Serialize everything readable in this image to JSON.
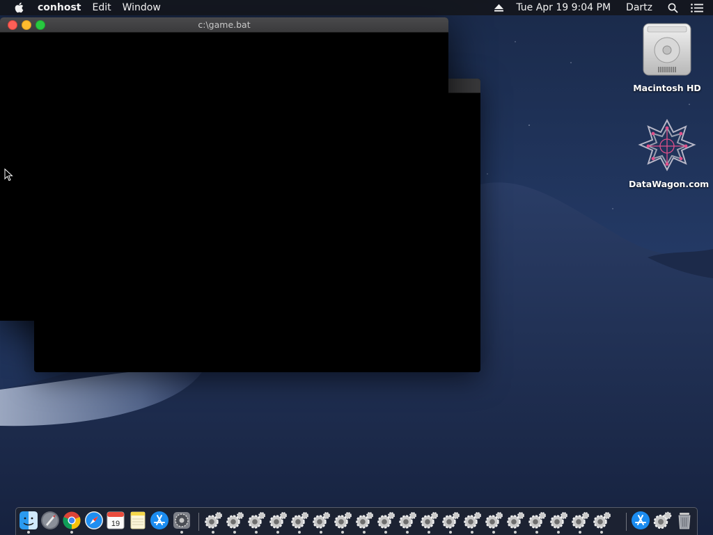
{
  "menubar": {
    "app_name": "conhost",
    "menus": [
      "Edit",
      "Window"
    ],
    "datetime": "Tue Apr 19  9:04 PM",
    "user": "Dartz",
    "icons": [
      "apple-icon",
      "eject-icon",
      "spotlight-icon",
      "notification-center-icon"
    ]
  },
  "window": {
    "title": "c:\\game.bat"
  },
  "desktop": {
    "icons": [
      {
        "label": "Macintosh HD",
        "icon": "hard-drive-icon"
      },
      {
        "label": "DataWagon.com",
        "icon": "network-volume-icon"
      }
    ]
  },
  "dock": {
    "calendar_day": "19",
    "apps": [
      "Finder",
      "Launchpad",
      "Google Chrome",
      "Safari",
      "Calendar",
      "Notes",
      "App Store",
      "System Preferences"
    ],
    "running_gear_count": 19,
    "trash": "Trash"
  },
  "colors": {
    "accent_close": "#fd5f57",
    "accent_minimize": "#febc2e",
    "accent_maximize": "#28c840",
    "menubar_bg": "#14161c"
  }
}
